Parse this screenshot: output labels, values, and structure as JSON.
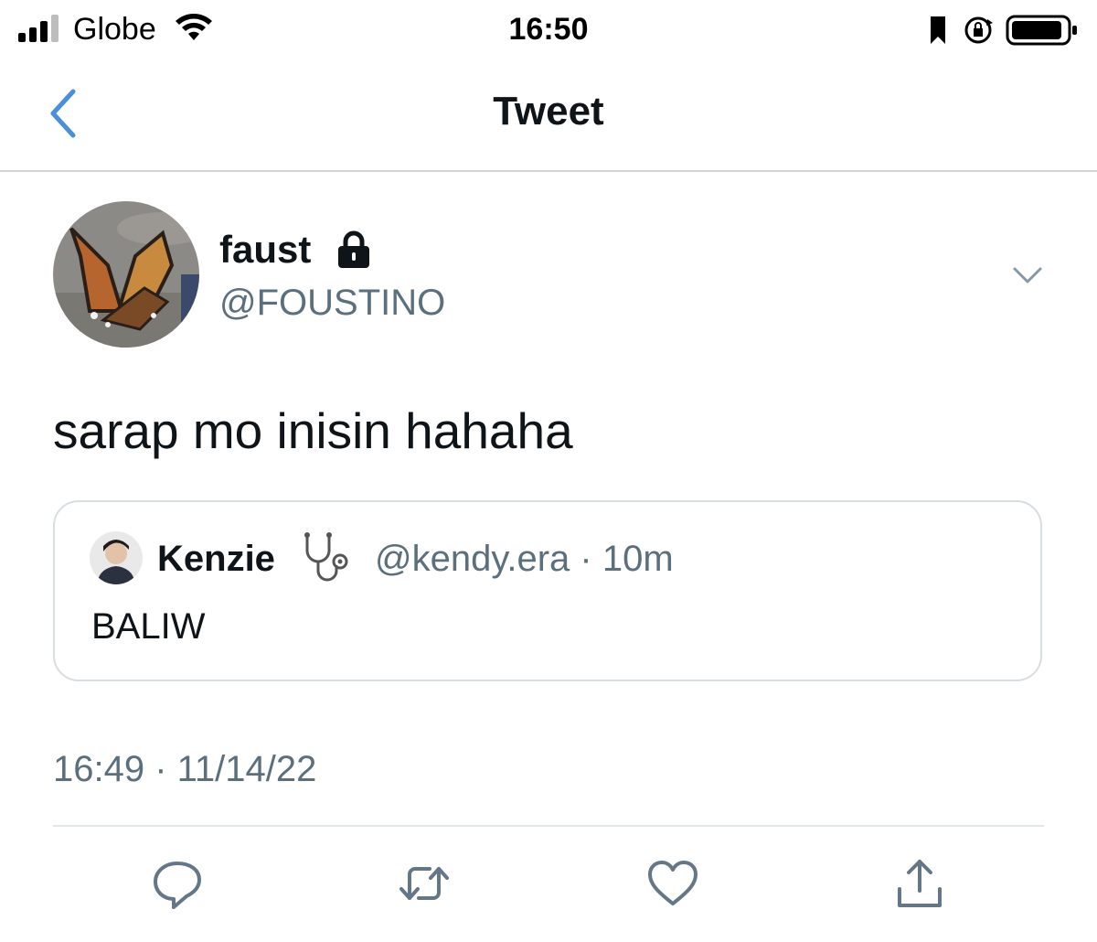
{
  "status_bar": {
    "carrier": "Globe",
    "time": "16:50"
  },
  "nav": {
    "title": "Tweet"
  },
  "tweet": {
    "display_name": "faust",
    "handle": "@FOUSTINO",
    "text": "sarap mo inisin hahaha",
    "timestamp": "16:49 · 11/14/22"
  },
  "quote": {
    "name": "Kenzie",
    "handle_time": "@kendy.era · 10m",
    "text": "BALIW"
  },
  "colors": {
    "accent": "#4a90d9",
    "secondary_text": "#5b6f7d",
    "divider": "#e1e6ea"
  },
  "icons": [
    "signal-icon",
    "wifi-icon",
    "bookmark-icon",
    "rotation-lock-icon",
    "battery-icon",
    "back-chevron-icon",
    "lock-icon",
    "chevron-down-icon",
    "stethoscope-icon",
    "reply-icon",
    "retweet-icon",
    "like-icon",
    "share-icon"
  ]
}
